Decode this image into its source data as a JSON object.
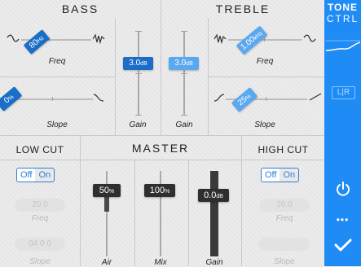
{
  "bass": {
    "title": "BASS",
    "freq": {
      "label": "Freq",
      "value": "80",
      "unit": "Hz"
    },
    "slope": {
      "label": "Slope",
      "value": "0",
      "unit": "%"
    },
    "gain": {
      "label": "Gain",
      "value": "3.0",
      "unit": "dB"
    }
  },
  "treble": {
    "title": "TREBLE",
    "gain": {
      "label": "Gain",
      "value": "3.0",
      "unit": "dB"
    },
    "freq": {
      "label": "Freq",
      "value": "1.00",
      "unit": "kHz"
    },
    "slope": {
      "label": "Slope",
      "value": "25",
      "unit": "%"
    }
  },
  "low_cut": {
    "title": "LOW CUT",
    "off_label": "Off",
    "on_label": "On",
    "freq": {
      "label": "Freq",
      "value": "20.0"
    },
    "slope": {
      "label": "Slope",
      "value": "04 0 0"
    }
  },
  "master": {
    "title": "MASTER",
    "air": {
      "label": "Air",
      "value": "50",
      "unit": "%"
    },
    "mix": {
      "label": "Mix",
      "value": "100",
      "unit": "%"
    },
    "gain": {
      "label": "Gain",
      "value": "0.0",
      "unit": "dB"
    }
  },
  "high_cut": {
    "title": "HIGH CUT",
    "off_label": "Off",
    "on_label": "On",
    "freq": {
      "label": "Freq",
      "value": "20.0"
    },
    "slope": {
      "label": "Slope",
      "value": ""
    }
  },
  "sidebar": {
    "title_line1": "TONE",
    "title_line2": "CTRL",
    "lr_label": "L|R",
    "dots": "•••"
  },
  "colors": {
    "accent": "#1f8bf5",
    "knob_blue": "#1a6ec8",
    "knob_light": "#5aa8f0",
    "knob_dark": "#2f2f2f"
  }
}
